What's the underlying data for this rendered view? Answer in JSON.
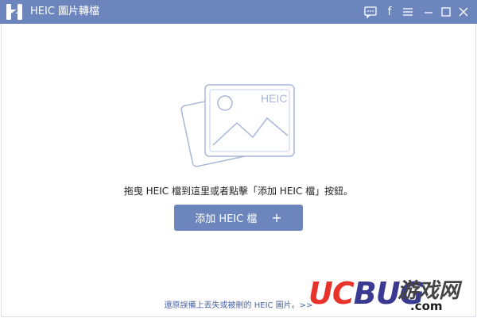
{
  "titlebar": {
    "title": "HEIC 圖片轉檔",
    "icons": [
      "chat-icon",
      "facebook-icon",
      "menu-icon",
      "minimize-icon",
      "maximize-icon",
      "close-icon"
    ],
    "facebook_glyph": "f"
  },
  "main": {
    "illustration_label": "HEIC",
    "hint": "拖曳 HEIC 檔到這里或者點擊「添加 HEIC 檔」按鈕。",
    "add_button_label": "添加 HEIC 檔",
    "add_button_plus": "+",
    "footer_link": "還原誤備上丟失或被刪的 HEIC 圖片。>>"
  },
  "watermark": {
    "brand_u": "U",
    "brand_c": "C",
    "brand_bug": "BUG",
    "brand_cn": "游戏网",
    "brand_com": ".com"
  },
  "colors": {
    "titlebar": "#6c86bd",
    "button": "#6c86bd",
    "illustration_stroke": "#a9b8d8",
    "link": "#4a64a5",
    "watermark_red": "#e8332a",
    "watermark_blue": "#3a3a92"
  }
}
